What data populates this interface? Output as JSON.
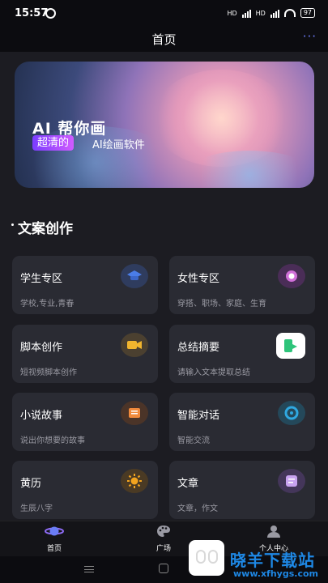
{
  "status_bar": {
    "time": "15:57",
    "sig1": "HD",
    "sig2": "HD",
    "battery": "97"
  },
  "header": {
    "title": "首页",
    "more": "···"
  },
  "banner": {
    "headline": "AI 帮你画",
    "tag": "超清的",
    "subtitle": "AI绘画软件"
  },
  "section": {
    "title": "文案创作"
  },
  "cards": [
    {
      "title": "学生专区",
      "desc": "学校,专业,青春",
      "icon": "graduation-cap-icon"
    },
    {
      "title": "女性专区",
      "desc": "穿搭、职场、家庭、生育",
      "icon": "female-icon"
    },
    {
      "title": "脚本创作",
      "desc": "短视频脚本创作",
      "icon": "video-camera-icon"
    },
    {
      "title": "总结摘要",
      "desc": "请输入文本提取总结",
      "icon": "summary-icon"
    },
    {
      "title": "小说故事",
      "desc": "说出你想要的故事",
      "icon": "book-icon"
    },
    {
      "title": "智能对话",
      "desc": "智能交流",
      "icon": "chat-icon"
    },
    {
      "title": "黄历",
      "desc": "生辰八字",
      "icon": "sun-icon"
    },
    {
      "title": "文章",
      "desc": "文章，作文",
      "icon": "article-icon"
    }
  ],
  "tabbar": {
    "home": "首页",
    "plaza": "广场",
    "profile": "个人中心"
  },
  "watermark": {
    "title": "晓羊下载站",
    "url": "www.xfhygs.com"
  },
  "colors": {
    "accent": "#6f7dff",
    "card_bg": "#2a2b33",
    "page_bg": "#1c1c22"
  }
}
